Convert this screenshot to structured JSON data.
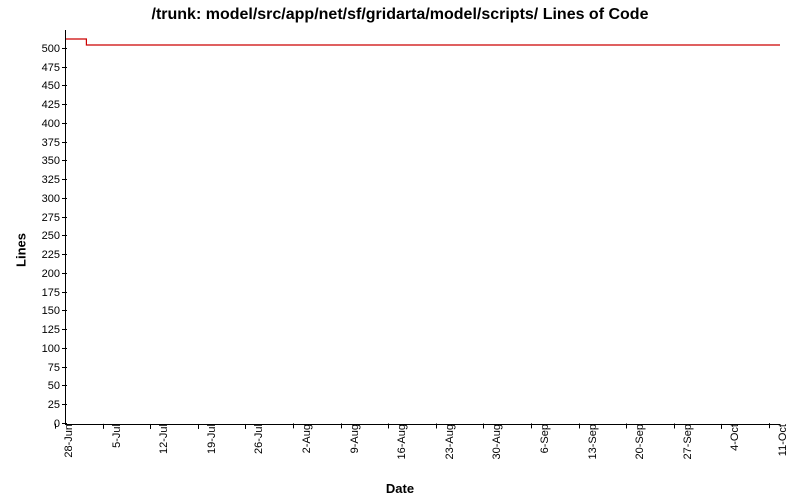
{
  "chart_data": {
    "type": "line",
    "title": "/trunk: model/src/app/net/sf/gridarta/model/scripts/ Lines of Code",
    "xlabel": "Date",
    "ylabel": "Lines",
    "ylim": [
      0,
      525
    ],
    "yticks": [
      0,
      25,
      50,
      75,
      100,
      125,
      150,
      175,
      200,
      225,
      250,
      275,
      300,
      325,
      350,
      375,
      400,
      425,
      450,
      475,
      500
    ],
    "categories": [
      "28-Jun",
      "5-Jul",
      "12-Jul",
      "19-Jul",
      "26-Jul",
      "2-Aug",
      "9-Aug",
      "16-Aug",
      "23-Aug",
      "30-Aug",
      "6-Sep",
      "13-Sep",
      "20-Sep",
      "27-Sep",
      "4-Oct",
      "11-Oct"
    ],
    "series": [
      {
        "name": "Lines of Code",
        "color": "#cc0000",
        "points": [
          {
            "x": "28-Jun",
            "y": 513
          },
          {
            "x": "1-Jul",
            "y": 513
          },
          {
            "x": "1-Jul",
            "y": 505
          },
          {
            "x": "11-Oct",
            "y": 505
          }
        ]
      }
    ]
  }
}
